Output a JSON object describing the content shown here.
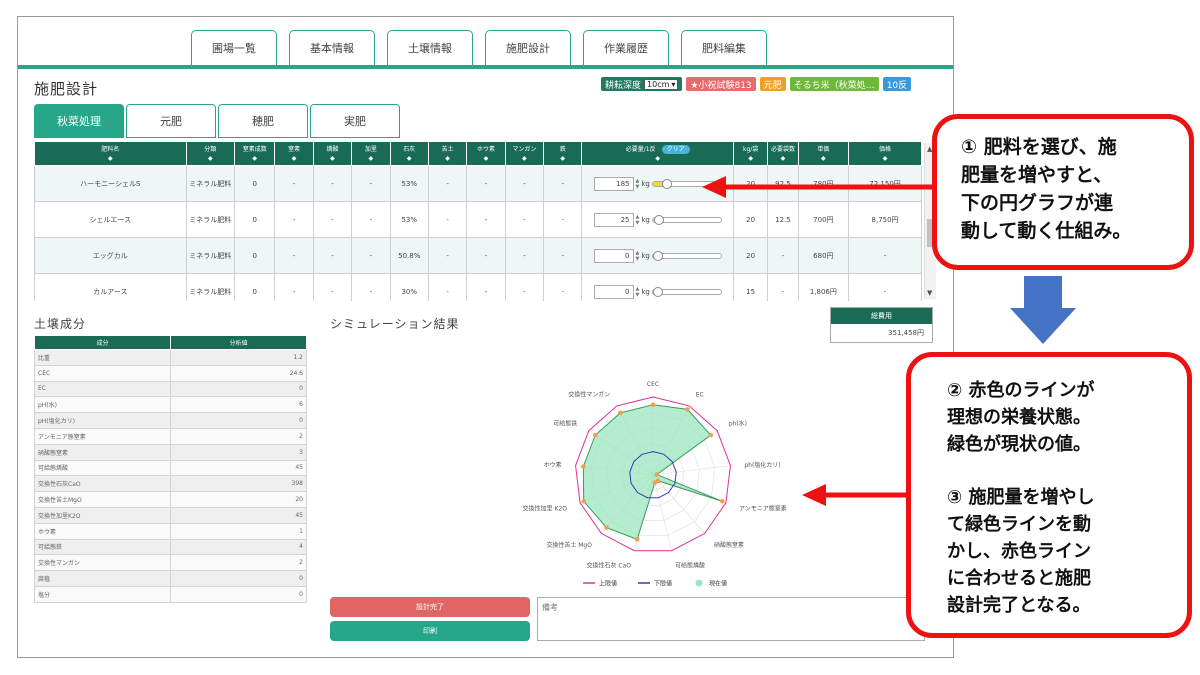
{
  "nav": {
    "tabs": [
      "圃場一覧",
      "基本情報",
      "土壌情報",
      "施肥設計",
      "作業履歴",
      "肥料編集"
    ]
  },
  "page": {
    "title": "施肥設計"
  },
  "tags": {
    "depth_label": "耕耘深度",
    "depth_value": "10cm",
    "field": "★小祝試験813",
    "base": "元肥",
    "crop": "そるち米（秋菜処…",
    "area": "10反"
  },
  "subtabs": [
    "秋菜処理",
    "元肥",
    "穂肥",
    "実肥"
  ],
  "table": {
    "headers": [
      "肥料名",
      "分類",
      "窒素成数",
      "窒素",
      "燐酸",
      "加里",
      "石灰",
      "苦土",
      "ホウ素",
      "マンガン",
      "鉄",
      "必要量/1反",
      "kg/袋",
      "必要袋数",
      "単価",
      "価格"
    ],
    "clear_label": "クリア",
    "unit": "kg",
    "rows": [
      {
        "name": "ハーモニーシェルS",
        "type": "ミネラル肥料",
        "c1": "0",
        "c2": "-",
        "c3": "-",
        "c4": "-",
        "lime": "53%",
        "c6": "-",
        "c7": "-",
        "c8": "-",
        "c9": "-",
        "qty": "185",
        "kgbag": "20",
        "bags": "92.5",
        "unit_price": "780円",
        "price": "72,150円"
      },
      {
        "name": "シェルエース",
        "type": "ミネラル肥料",
        "c1": "0",
        "c2": "-",
        "c3": "-",
        "c4": "-",
        "lime": "53%",
        "c6": "-",
        "c7": "-",
        "c8": "-",
        "c9": "-",
        "qty": "25",
        "kgbag": "20",
        "bags": "12.5",
        "unit_price": "700円",
        "price": "8,750円"
      },
      {
        "name": "エッグカル",
        "type": "ミネラル肥料",
        "c1": "0",
        "c2": "-",
        "c3": "-",
        "c4": "-",
        "lime": "50.8%",
        "c6": "-",
        "c7": "-",
        "c8": "-",
        "c9": "-",
        "qty": "0",
        "kgbag": "20",
        "bags": "-",
        "unit_price": "680円",
        "price": "-"
      },
      {
        "name": "カルアース",
        "type": "ミネラル肥料",
        "c1": "0",
        "c2": "-",
        "c3": "-",
        "c4": "-",
        "lime": "30%",
        "c6": "-",
        "c7": "-",
        "c8": "-",
        "c9": "-",
        "qty": "0",
        "kgbag": "15",
        "bags": "-",
        "unit_price": "1,806円",
        "price": "-"
      }
    ],
    "slider_fraction": [
      0.15,
      0.02,
      0,
      0
    ]
  },
  "soil": {
    "title": "土壌成分",
    "headers": [
      "成分",
      "分析値"
    ],
    "rows": [
      {
        "name": "比重",
        "value": "1.2"
      },
      {
        "name": "CEC",
        "value": "24.6"
      },
      {
        "name": "EC",
        "value": "0"
      },
      {
        "name": "pH(水)",
        "value": "6"
      },
      {
        "name": "pH(塩化カリ)",
        "value": "0"
      },
      {
        "name": "アンモニア態窒素",
        "value": "2"
      },
      {
        "name": "硝酸態窒素",
        "value": "3"
      },
      {
        "name": "可給態燐酸",
        "value": "45"
      },
      {
        "name": "交換性石灰CaO",
        "value": "398"
      },
      {
        "name": "交換性苦土MgO",
        "value": "20"
      },
      {
        "name": "交換性加里K2O",
        "value": "45"
      },
      {
        "name": "ホウ素",
        "value": "1"
      },
      {
        "name": "可給態鉄",
        "value": "4"
      },
      {
        "name": "交換性マンガン",
        "value": "2"
      },
      {
        "name": "腐植",
        "value": "0"
      },
      {
        "name": "塩分",
        "value": "0"
      }
    ]
  },
  "simulation": {
    "title": "シミュレーション結果",
    "axes": [
      "CEC",
      "EC",
      "ph(水)",
      "ph(塩化カリ)",
      "アンモニア態窒素",
      "硝酸態窒素",
      "可給態燐酸",
      "交換性石灰 CaO",
      "交換性苦土 MgO",
      "交換性加里 K2O",
      "ホウ素",
      "可給態鉄",
      "交換性マンガン"
    ],
    "legend": [
      "上限値",
      "下限値",
      "現在値"
    ]
  },
  "chart_data": {
    "type": "radar",
    "categories": [
      "CEC",
      "EC",
      "ph(水)",
      "ph(塩化カリ)",
      "アンモニア態窒素",
      "硝酸態窒素",
      "可給態燐酸",
      "交換性石灰 CaO",
      "交換性苦土 MgO",
      "交換性加里 K2O",
      "ホウ素",
      "可給態鉄",
      "交換性マンガン"
    ],
    "series": [
      {
        "name": "上限値",
        "color": "#e0309a",
        "values": [
          1.0,
          1.0,
          1.0,
          1.0,
          1.0,
          1.0,
          1.0,
          1.0,
          1.0,
          1.0,
          1.0,
          1.0,
          1.0
        ]
      },
      {
        "name": "下限値",
        "color": "#2f3fb0",
        "values": [
          0.3,
          0.3,
          0.3,
          0.3,
          0.3,
          0.3,
          0.3,
          0.3,
          0.3,
          0.3,
          0.3,
          0.3,
          0.3
        ]
      },
      {
        "name": "現在値",
        "color": "#3c9a5a",
        "values": [
          0.9,
          0.95,
          0.9,
          0.05,
          0.95,
          0.1,
          0.1,
          0.85,
          0.9,
          0.95,
          0.9,
          0.9,
          0.9
        ]
      }
    ]
  },
  "cost": {
    "label": "総費用",
    "value": "351,458円"
  },
  "buttons": {
    "done": "設計完了",
    "print": "印刷"
  },
  "note": {
    "placeholder": "備考"
  },
  "callouts": {
    "c1_lines": [
      "① 肥料を選び、施",
      "肥量を増やすと、",
      "下の円グラフが連",
      "動して動く仕組み。"
    ],
    "c2_lines_a": [
      "② 赤色のラインが",
      "理想の栄養状態。",
      "緑色が現状の値。"
    ],
    "c2_lines_b": [
      "③ 施肥量を増やし",
      "て緑色ラインを動",
      "かし、赤色ライン",
      "に合わせると施肥",
      "設計完了となる。"
    ]
  }
}
